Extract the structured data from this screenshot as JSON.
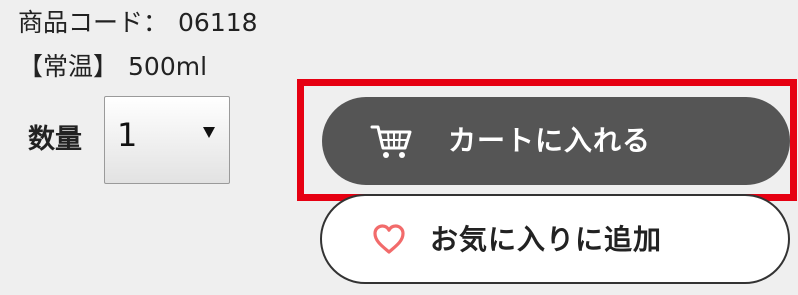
{
  "product": {
    "code_label": "商品コード：",
    "code_value": "06118",
    "storage": "【常温】",
    "volume": "500ml"
  },
  "quantity": {
    "label": "数量",
    "selected": "1"
  },
  "cart_button": {
    "label": "カートに入れる",
    "icon": "cart-icon"
  },
  "favorite_button": {
    "label": "お気に入りに追加",
    "icon": "heart-icon"
  },
  "colors": {
    "highlight_border": "#e60012",
    "cart_button_bg": "#555555",
    "heart": "#f26b6b",
    "page_bg": "#efefef"
  }
}
